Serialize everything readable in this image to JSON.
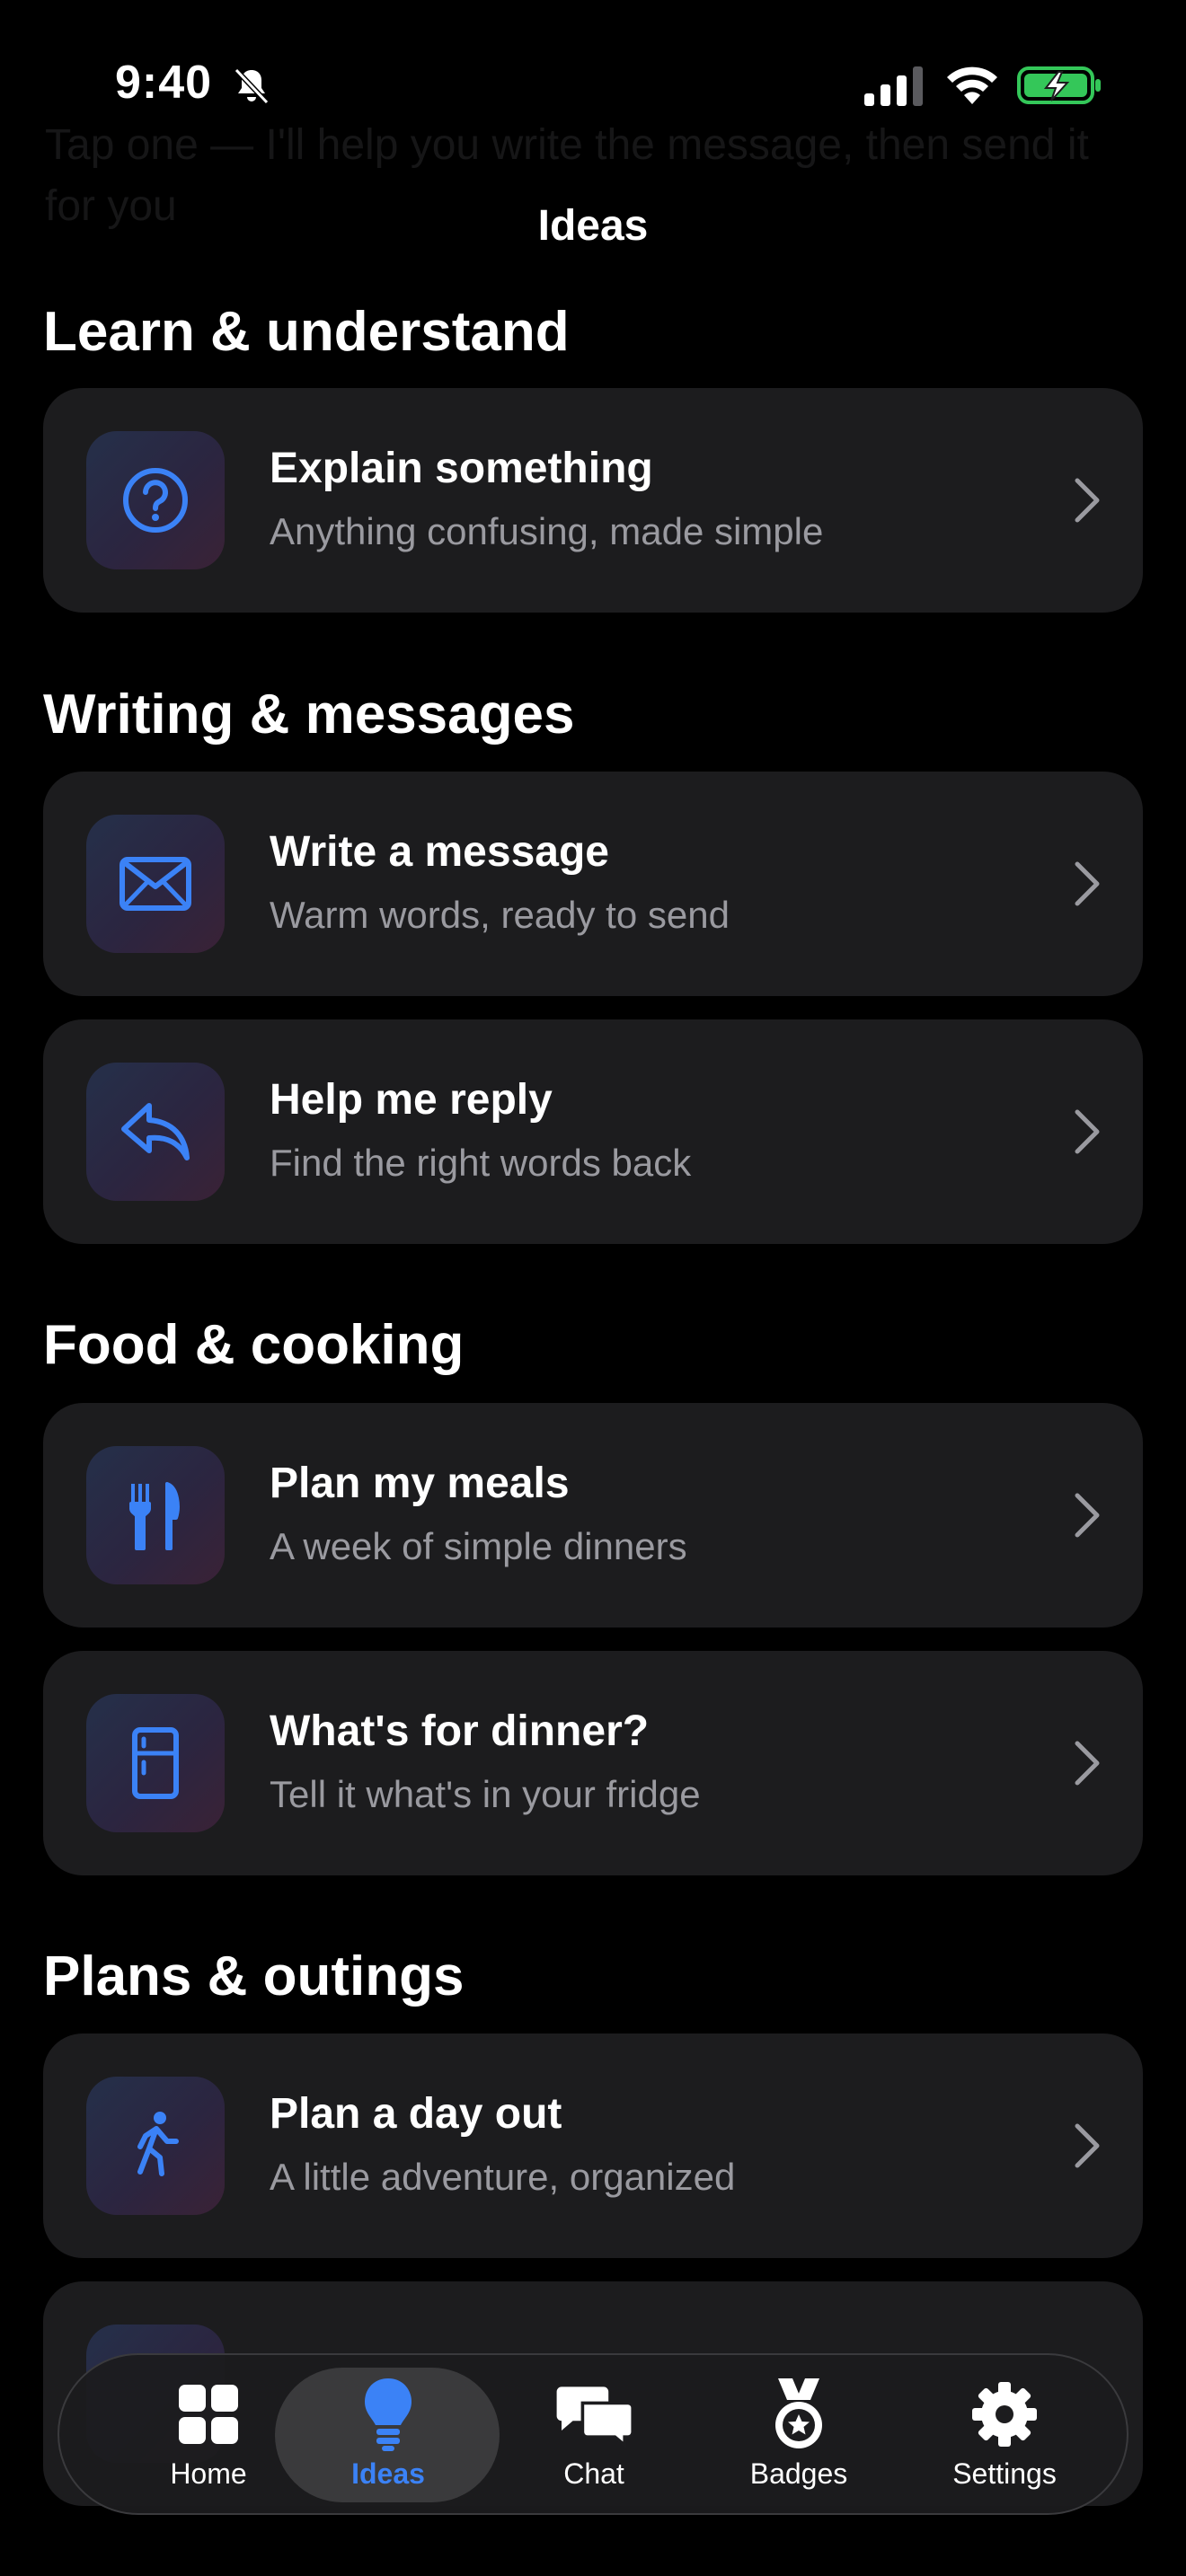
{
  "status_bar": {
    "time": "9:40"
  },
  "background_text": "Tap one — I'll help you write the message, then send it for you",
  "nav": {
    "title": "Ideas"
  },
  "sections": [
    {
      "title": "Learn & understand",
      "cards": [
        {
          "title": "Explain something",
          "subtitle": "Anything confusing, made simple",
          "icon": "question-circle-icon"
        }
      ]
    },
    {
      "title": "Writing & messages",
      "cards": [
        {
          "title": "Write a message",
          "subtitle": "Warm words, ready to send",
          "icon": "envelope-icon"
        },
        {
          "title": "Help me reply",
          "subtitle": "Find the right words back",
          "icon": "reply-arrow-icon"
        }
      ]
    },
    {
      "title": "Food & cooking",
      "cards": [
        {
          "title": "Plan my meals",
          "subtitle": "A week of simple dinners",
          "icon": "fork-knife-icon"
        },
        {
          "title": "What's for dinner?",
          "subtitle": "Tell it what's in your fridge",
          "icon": "fridge-icon"
        }
      ]
    },
    {
      "title": "Plans & outings",
      "cards": [
        {
          "title": "Plan a day out",
          "subtitle": "A little adventure, organized",
          "icon": "walking-figure-icon"
        }
      ]
    }
  ],
  "tabbar": {
    "items": [
      {
        "label": "Home",
        "icon": "grid-icon"
      },
      {
        "label": "Ideas",
        "icon": "lightbulb-icon",
        "active": true
      },
      {
        "label": "Chat",
        "icon": "chat-bubbles-icon"
      },
      {
        "label": "Badges",
        "icon": "medal-icon"
      },
      {
        "label": "Settings",
        "icon": "gear-icon"
      }
    ]
  },
  "colors": {
    "accent": "#3b82f6",
    "card_bg": "#1c1c1e",
    "subtitle": "#9a9aa0",
    "battery": "#34c759"
  }
}
